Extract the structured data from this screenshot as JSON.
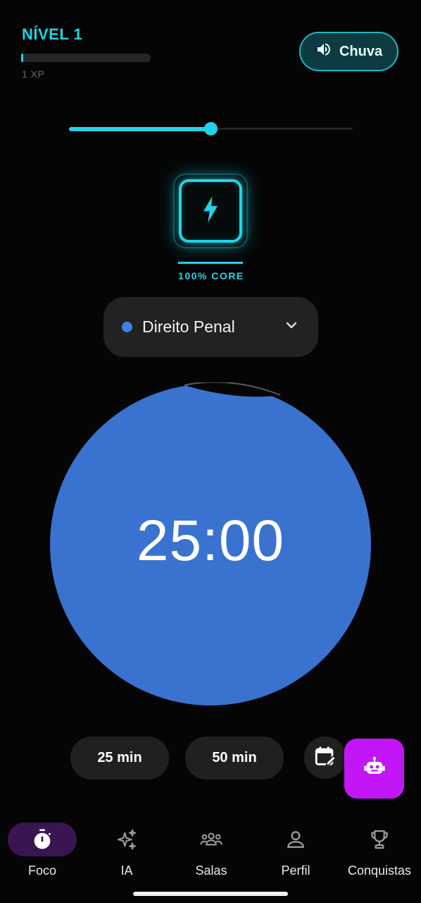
{
  "header": {
    "level_label": "NÍVEL 1",
    "xp_text": "1 XP",
    "xp_progress": 0.01
  },
  "sound": {
    "label": "Chuva",
    "icon": "volume-icon",
    "volume": 0.5
  },
  "core": {
    "icon": "lightning-icon",
    "label": "100% CORE",
    "level_percent": 100
  },
  "subject": {
    "name": "Direito Penal",
    "dot_color": "#3f7fe6"
  },
  "timer": {
    "time": "25:00",
    "color": "#3a72d0"
  },
  "presets": [
    {
      "label": "25 min"
    },
    {
      "label": "50 min"
    }
  ],
  "actions": {
    "calendar_icon": "calendar-edit-icon",
    "ai_icon": "robot-icon",
    "ai_color": "#c316f7"
  },
  "nav": {
    "items": [
      {
        "label": "Foco",
        "icon": "stopwatch-icon",
        "active": true
      },
      {
        "label": "IA",
        "icon": "sparkles-icon",
        "active": false
      },
      {
        "label": "Salas",
        "icon": "group-icon",
        "active": false
      },
      {
        "label": "Perfil",
        "icon": "person-icon",
        "active": false
      },
      {
        "label": "Conquistas",
        "icon": "trophy-icon",
        "active": false
      }
    ]
  },
  "colors": {
    "accent": "#22d3e6",
    "background": "#050505",
    "nav_active_pill": "#3a1651"
  }
}
